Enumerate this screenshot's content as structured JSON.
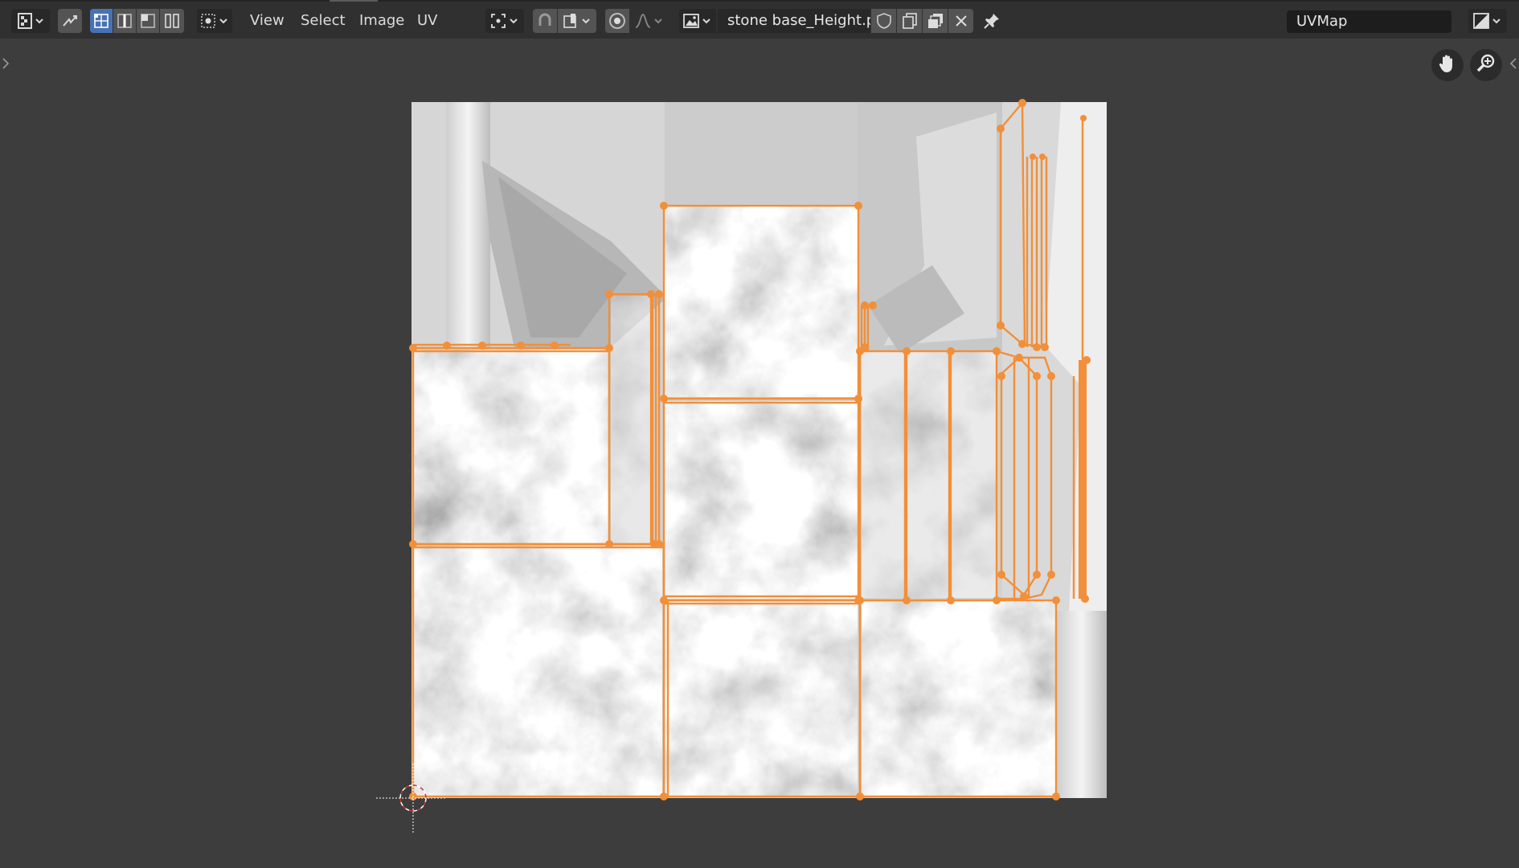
{
  "header": {
    "menus": {
      "view": "View",
      "select": "Select",
      "image": "Image",
      "uv": "UV"
    },
    "image_name": "stone base_Height.p..",
    "uv_map": "UVMap"
  },
  "colors": {
    "header_bg": "#303030",
    "viewport_bg": "#3d3d3d",
    "selection_accent": "#4772b3",
    "uv_edge": "#f28f38"
  },
  "icons": [
    "editor-type-icon",
    "sync-selection-icon",
    "vertex-select-icon",
    "edge-select-icon",
    "face-select-icon",
    "island-select-icon",
    "sticky-selection-icon",
    "pivot-icon",
    "snap-icon",
    "snap-target-icon",
    "proportional-edit-icon",
    "falloff-icon",
    "image-icon",
    "fake-user-shield-icon",
    "new-image-icon",
    "open-image-icon",
    "unlink-icon",
    "pin-icon",
    "display-channels-icon",
    "pan-hand-icon",
    "zoom-icon",
    "2d-cursor-icon"
  ]
}
